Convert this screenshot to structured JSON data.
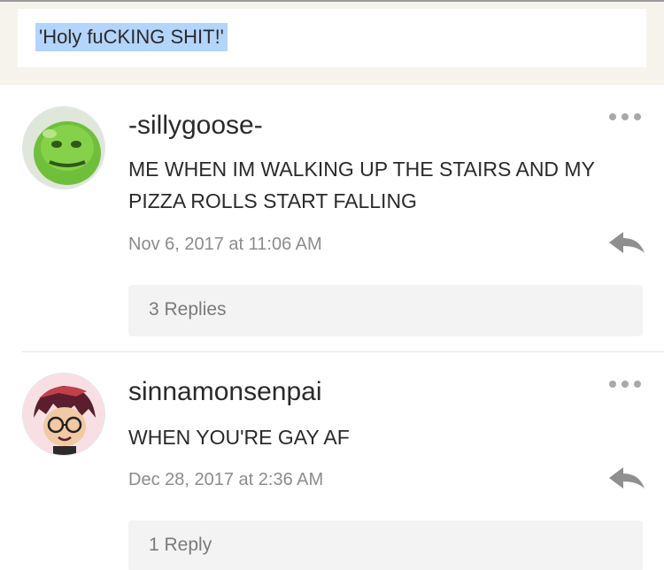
{
  "quote": {
    "text": "'Holy fuCKING SHIT!'"
  },
  "comments": [
    {
      "username": "-sillygoose-",
      "text": "ME WHEN IM WALKING UP THE STAIRS AND MY PIZZA ROLLS START FALLING",
      "timestamp": "Nov 6, 2017 at 11:06 AM",
      "replies": "3 Replies",
      "avatar_icon": "green-creature-avatar"
    },
    {
      "username": "sinnamonsenpai",
      "text": "WHEN YOU'RE GAY AF",
      "timestamp": "Dec 28, 2017 at 2:36 AM",
      "replies": "1 Reply",
      "avatar_icon": "glasses-character-avatar"
    }
  ],
  "colors": {
    "selection": "#b3d4fc",
    "band": "#f6f3ec",
    "muted": "#8c8c8c"
  }
}
